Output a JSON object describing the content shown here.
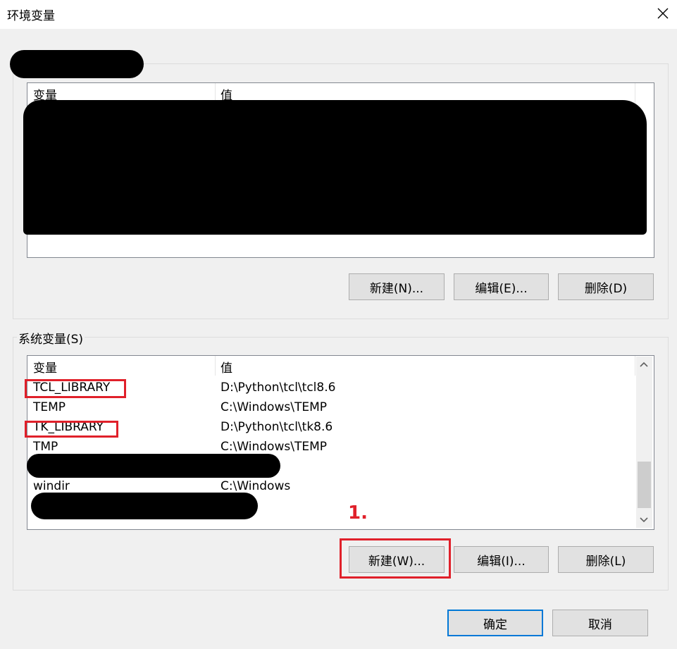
{
  "window": {
    "title": "环境变量"
  },
  "user_vars": {
    "group_label": "",
    "headers": {
      "name": "变量",
      "value": "值"
    },
    "buttons": {
      "new": "新建(N)...",
      "edit": "编辑(E)...",
      "delete": "删除(D)"
    }
  },
  "system_vars": {
    "group_label": "系统变量(S)",
    "headers": {
      "name": "变量",
      "value": "值"
    },
    "rows": [
      {
        "name": "TCL_LIBRARY",
        "value": "D:\\Python\\tcl\\tcl8.6"
      },
      {
        "name": "TEMP",
        "value": "C:\\Windows\\TEMP"
      },
      {
        "name": "TK_LIBRARY",
        "value": "D:\\Python\\tcl\\tk8.6"
      },
      {
        "name": "TMP",
        "value": "C:\\Windows\\TEMP"
      },
      {
        "name": "",
        "value": ""
      },
      {
        "name": "windir",
        "value": "C:\\Windows"
      }
    ],
    "buttons": {
      "new": "新建(W)...",
      "edit": "编辑(I)...",
      "delete": "删除(L)"
    }
  },
  "footer": {
    "ok": "确定",
    "cancel": "取消"
  },
  "annotation": {
    "step_label": "1."
  },
  "colors": {
    "highlight": "#e0202a",
    "default_button_border": "#0078d7"
  },
  "icons": {
    "close": "close-icon",
    "scroll_up": "chevron-up-icon",
    "scroll_down": "chevron-down-icon"
  }
}
